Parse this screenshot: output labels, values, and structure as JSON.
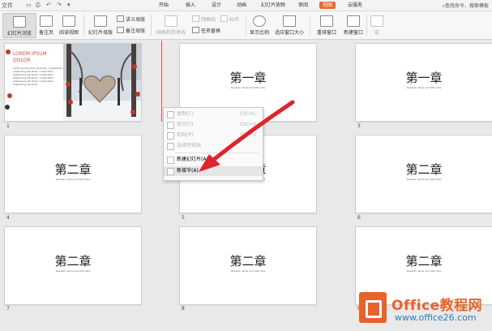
{
  "tabs_bar": {
    "file_label": "文件",
    "tabs": [
      "开始",
      "插入",
      "设计",
      "动画",
      "幻灯片放映",
      "审阅",
      "视图",
      "云服务"
    ],
    "active_tab": "视图",
    "search_text": "查找命令、搜索模板"
  },
  "ribbon": {
    "normal_view": "幻灯片浏览",
    "notes_page": "备注页",
    "reading_view": "阅读视图",
    "slide_master": "幻灯片母版",
    "handout_master": "讲义母版",
    "notes_master": "备注母版",
    "grid_guides": "网格和参考线",
    "gridlines": "网格线",
    "ruler": "标尺",
    "task_pane": "任务窗格",
    "zoom": "显示比例",
    "fit_window": "适应窗口大小",
    "arrange": "重排窗口",
    "new_window": "新建窗口",
    "macro": "宏"
  },
  "slides": [
    {
      "num": "1",
      "title_lines": [
        "LOREM IPSUM",
        "DOLOR"
      ],
      "body": "Lorem ipsum dolor sit amet, consectetur adipisicing elit amet, consectetur adipisicing elit amet, consectetur adipisicing elit amet, consectetur adipisicing elit amet, consectetur adipisicing elit amet"
    },
    {
      "num": "2",
      "title": "第一章",
      "subtitle": "Speaker name and title here"
    },
    {
      "num": "3",
      "title": "第一章",
      "subtitle": "Speaker name and title here"
    },
    {
      "num": "4",
      "title": "第二章",
      "subtitle": "Speaker name and title here"
    },
    {
      "num": "5",
      "title": "第二章",
      "subtitle": "Speaker name and title here"
    },
    {
      "num": "6",
      "title": "第二章",
      "subtitle": "Speaker name and title here"
    },
    {
      "num": "7",
      "title": "第二章",
      "subtitle": "Speaker name and title here"
    },
    {
      "num": "8",
      "title": "第二章",
      "subtitle": "Speaker name and title here"
    },
    {
      "num": "9",
      "title": "第二章",
      "subtitle": "Speaker name and title here"
    }
  ],
  "context_menu": {
    "copy": "复制(C)",
    "copy_key": "Ctrl+C",
    "cut": "剪切(T)",
    "cut_key": "Ctrl+X",
    "paste": "粘贴(P)",
    "paste_key": "Ctrl+V",
    "paste_special": "选择性粘贴",
    "new_slide": "新建幻灯片(A)",
    "new_section": "新增节(A)"
  },
  "watermark": {
    "brand": "Office教程网",
    "url": "www.office26.com"
  },
  "colors": {
    "accent": "#ea6c2c",
    "arrow": "#e0242c",
    "watermark_blue": "#2c7cc4"
  }
}
